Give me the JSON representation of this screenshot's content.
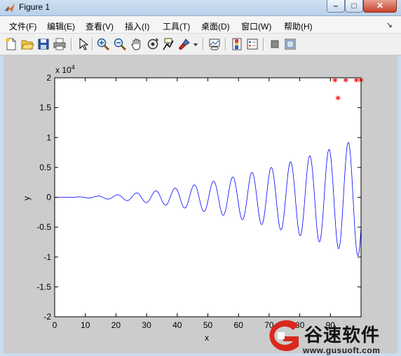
{
  "window": {
    "title": "Figure 1",
    "minimize_glyph": "–",
    "maximize_glyph": "□",
    "close_glyph": "✕"
  },
  "menu": {
    "items": [
      "文件(F)",
      "编辑(E)",
      "查看(V)",
      "插入(I)",
      "工具(T)",
      "桌面(D)",
      "窗口(W)",
      "帮助(H)"
    ],
    "overflow_glyph": "↘"
  },
  "toolbar": {
    "icons": [
      "new-figure-icon",
      "open-file-icon",
      "save-icon",
      "print-icon",
      "edit-plot-arrow-icon",
      "zoom-in-icon",
      "zoom-out-icon",
      "pan-hand-icon",
      "rotate-3d-icon",
      "data-cursor-icon",
      "brush-icon",
      "link-plot-icon",
      "insert-colorbar-icon",
      "insert-legend-icon",
      "hide-plot-tools-icon",
      "show-plot-tools-icon"
    ]
  },
  "chart_data": {
    "type": "line",
    "title": "",
    "xlabel": "x",
    "ylabel": "y",
    "xlim": [
      0,
      100
    ],
    "ylim": [
      -20000,
      20000
    ],
    "y_exponent_label": "x 10",
    "y_exponent_power": "4",
    "xticks": [
      0,
      10,
      20,
      30,
      40,
      50,
      60,
      70,
      80,
      90
    ],
    "xtick_labels": [
      "0",
      "10",
      "20",
      "30",
      "40",
      "50",
      "60",
      "70",
      "80",
      "90"
    ],
    "yticks": [
      -20000,
      -15000,
      -10000,
      -5000,
      0,
      5000,
      10000,
      15000,
      20000
    ],
    "ytick_labels": [
      "-2",
      "-1.5",
      "-1",
      "-0.5",
      "0",
      "0.5",
      "1",
      "1.5",
      "2"
    ],
    "grid": false,
    "series": [
      {
        "style": "blue-line",
        "color": "#0000ff",
        "function": "y = x^2 * sin(x)",
        "x_range": [
          0,
          100
        ],
        "samples": 3000
      },
      {
        "style": "red-star-markers",
        "color": "#ff0000",
        "points": [
          [
            91.5,
            19500
          ],
          [
            92.5,
            16500
          ],
          [
            95,
            19500
          ],
          [
            98.5,
            19500
          ],
          [
            100,
            19500
          ]
        ]
      }
    ]
  },
  "watermark": {
    "title": "谷速软件",
    "url": "www.gusuoft.com",
    "accent_color": "#d9281e"
  }
}
